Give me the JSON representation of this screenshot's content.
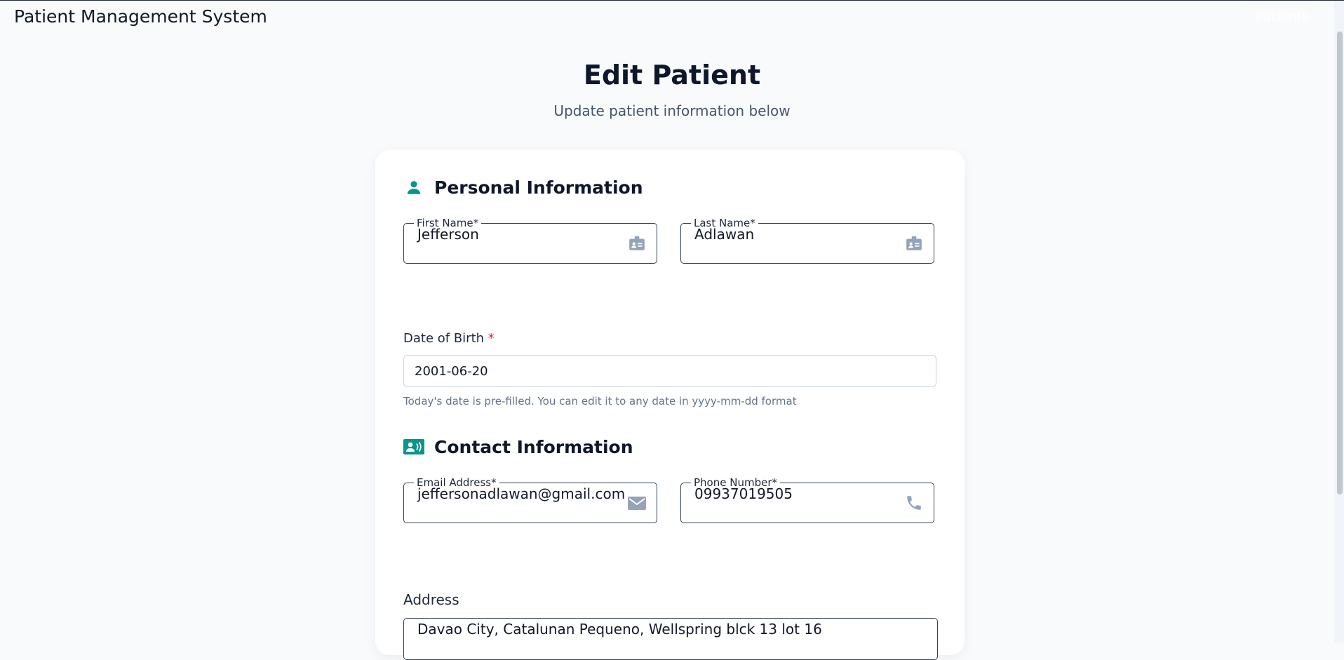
{
  "header": {
    "app_title": "Patient Management System",
    "nav_link": "Patients"
  },
  "page": {
    "title": "Edit Patient",
    "subtitle": "Update patient information below"
  },
  "personal": {
    "section_title": "Personal Information",
    "section_icon": "person-icon",
    "first_name": {
      "label": "First Name*",
      "value": "Jefferson",
      "icon": "id-badge-icon"
    },
    "last_name": {
      "label": "Last Name*",
      "value": "Adlawan",
      "icon": "id-badge-icon"
    },
    "dob": {
      "label": "Date of Birth",
      "required_mark": "*",
      "value": "2001-06-20",
      "helper": "Today's date is pre-filled. You can edit it to any date in yyyy-mm-dd format"
    }
  },
  "contact": {
    "section_title": "Contact Information",
    "section_icon": "contact-card-icon",
    "email": {
      "label": "Email Address*",
      "value": "jeffersonadlawan@gmail.com",
      "icon": "mail-icon"
    },
    "phone": {
      "label": "Phone Number*",
      "value": "09937019505",
      "icon": "phone-icon"
    },
    "address": {
      "label": "Address",
      "value": "Davao City, Catalunan Pequeno, Wellspring blck 13 lot 16"
    }
  },
  "colors": {
    "accent": "#0d9488",
    "icon_gray": "#94a3b8",
    "required": "#dc2626",
    "page_bg": "#f8fafc"
  }
}
